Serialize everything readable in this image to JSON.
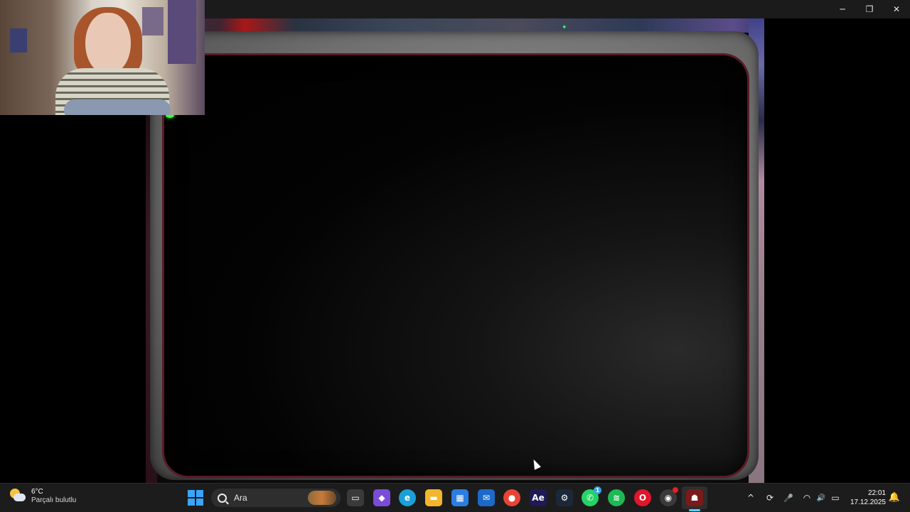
{
  "window": {
    "controls": {
      "minimize_glyph": "─",
      "restore_glyph": "❐",
      "close_glyph": "✕"
    }
  },
  "game": {
    "green_glyph": "✦"
  },
  "taskbar": {
    "weather": {
      "temperature": "6°C",
      "condition": "Parçalı bulutlu"
    },
    "search": {
      "placeholder": "Ara"
    },
    "apps": [
      {
        "name": "task-view",
        "glyph": "▭",
        "color": "#3a3a3a"
      },
      {
        "name": "copilot",
        "glyph": "◆",
        "color": "#7a4cd8"
      },
      {
        "name": "edge",
        "glyph": "e",
        "color": "#1aa0d8"
      },
      {
        "name": "file-explorer",
        "glyph": "▬",
        "color": "#f2b62e"
      },
      {
        "name": "ms-store",
        "glyph": "▦",
        "color": "#2b7de0"
      },
      {
        "name": "outlook",
        "glyph": "✉",
        "color": "#1b6ac9"
      },
      {
        "name": "chrome",
        "glyph": "●",
        "color": "#e84436"
      },
      {
        "name": "after-effects",
        "glyph": "Ae",
        "color": "#1f1a55"
      },
      {
        "name": "steam",
        "glyph": "⚙",
        "color": "#1b2838"
      },
      {
        "name": "whatsapp",
        "glyph": "✆",
        "color": "#25d366",
        "badge": "1"
      },
      {
        "name": "spotify",
        "glyph": "≋",
        "color": "#1db954"
      },
      {
        "name": "opera",
        "glyph": "O",
        "color": "#e0162b"
      },
      {
        "name": "obs",
        "glyph": "◉",
        "color": "#3a3a3a"
      },
      {
        "name": "fnaf-game",
        "glyph": "☗",
        "color": "#7a1a1a"
      }
    ],
    "tray": {
      "chevron_glyph": "^",
      "sync_glyph": "⟳",
      "mic_glyph": "🎤",
      "wifi_glyph": "◠",
      "volume_glyph": "🔊",
      "battery_glyph": "▭"
    },
    "clock": {
      "time": "22:01",
      "date": "17.12.2025"
    },
    "notification_glyph": "🔔"
  }
}
